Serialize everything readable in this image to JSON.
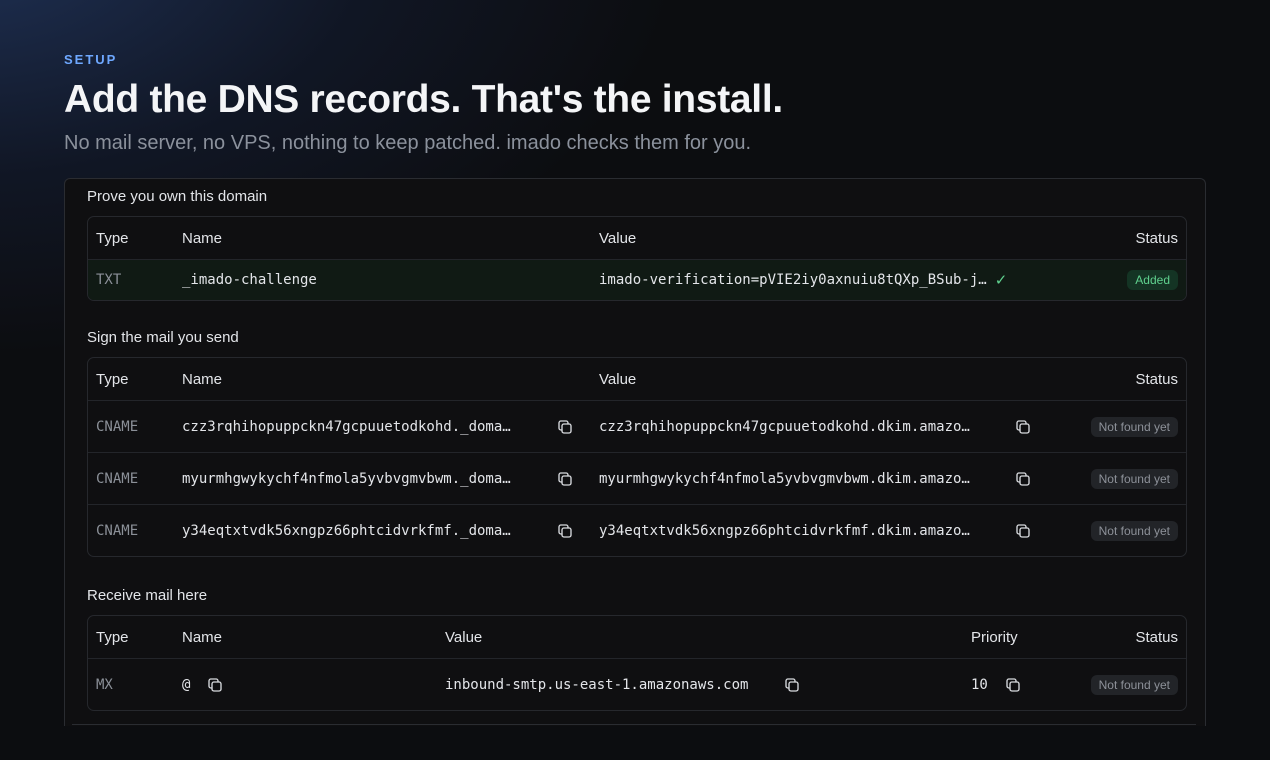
{
  "header": {
    "eyebrow": "SETUP",
    "title": "Add the DNS records. That's the install.",
    "subtitle": "No mail server, no VPS, nothing to keep patched. imado checks them for you."
  },
  "sections": {
    "verify": {
      "title": "Prove you own this domain",
      "columns": {
        "type": "Type",
        "name": "Name",
        "value": "Value",
        "status": "Status"
      },
      "rows": [
        {
          "type": "TXT",
          "name": "_imado-challenge",
          "value": "imado-verification=pVIE2iy0axnuiu8tQXp_BSub-j…",
          "status": "Added"
        }
      ]
    },
    "dkim": {
      "title": "Sign the mail you send",
      "columns": {
        "type": "Type",
        "name": "Name",
        "value": "Value",
        "status": "Status"
      },
      "rows": [
        {
          "type": "CNAME",
          "name": "czz3rqhihopuppckn47gcpuuetodkohd._doma…",
          "value": "czz3rqhihopuppckn47gcpuuetodkohd.dkim.amazo…",
          "status": "Not found yet"
        },
        {
          "type": "CNAME",
          "name": "myurmhgwykychf4nfmola5yvbvgmvbwm._doma…",
          "value": "myurmhgwykychf4nfmola5yvbvgmvbwm.dkim.amazo…",
          "status": "Not found yet"
        },
        {
          "type": "CNAME",
          "name": "y34eqtxtvdk56xngpz66phtcidvrkfmf._doma…",
          "value": "y34eqtxtvdk56xngpz66phtcidvrkfmf.dkim.amazo…",
          "status": "Not found yet"
        }
      ]
    },
    "mx": {
      "title": "Receive mail here",
      "columns": {
        "type": "Type",
        "name": "Name",
        "value": "Value",
        "priority": "Priority",
        "status": "Status"
      },
      "rows": [
        {
          "type": "MX",
          "name": "@",
          "value": "inbound-smtp.us-east-1.amazonaws.com",
          "priority": "10",
          "status": "Not found yet"
        }
      ]
    }
  },
  "icons": {
    "copy": "copy-icon",
    "check": "check-icon"
  },
  "colors": {
    "accent": "#6ea8ff",
    "success": "#5fd18e",
    "muted": "#8d9199"
  }
}
